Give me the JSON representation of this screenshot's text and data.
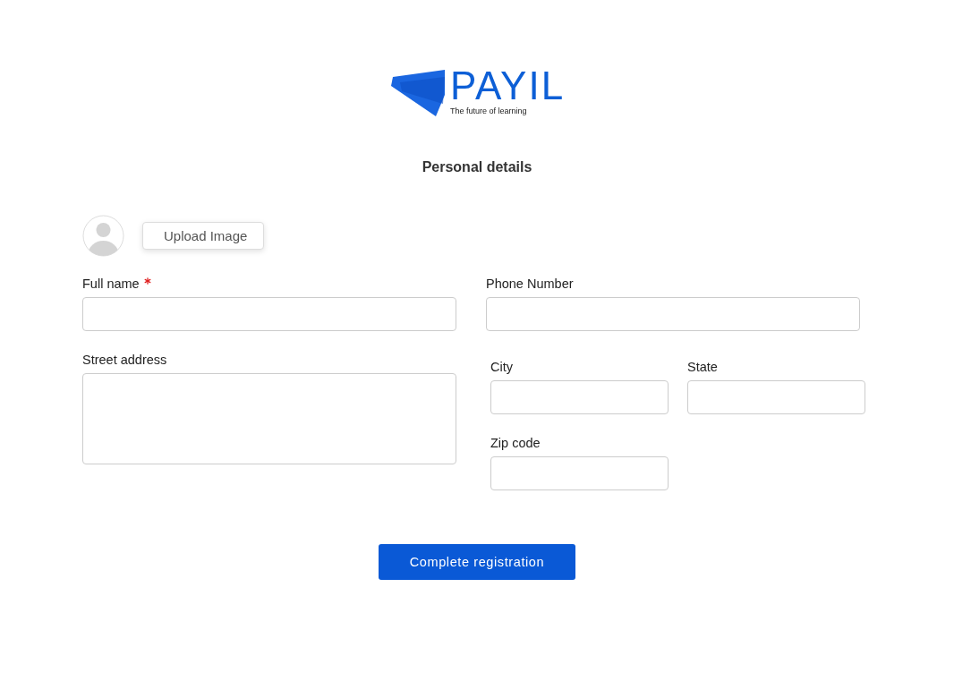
{
  "logo": {
    "name": "PAYIL",
    "tagline": "The future of learning"
  },
  "title": "Personal details",
  "upload_button": "Upload Image",
  "fields": [
    {
      "label": "Full name",
      "required": true,
      "kind": "input"
    },
    {
      "label": "Phone Number",
      "required": false,
      "kind": "input"
    },
    {
      "label": "Street address",
      "required": false,
      "kind": "textarea"
    },
    {
      "label": "City",
      "required": false,
      "kind": "input"
    },
    {
      "label": "State",
      "required": false,
      "kind": "input"
    },
    {
      "label": "Zip code",
      "required": false,
      "kind": "input"
    }
  ],
  "submit_button": "Complete registration"
}
